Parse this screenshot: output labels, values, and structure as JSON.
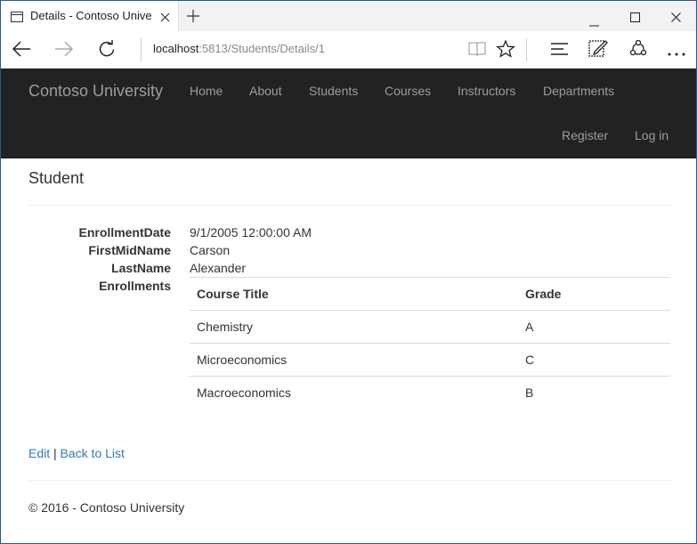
{
  "browser": {
    "tab_title": "Details - Contoso Unive",
    "url_host": "localhost",
    "url_rest": ":5813/Students/Details/1"
  },
  "site": {
    "brand": "Contoso University",
    "nav": [
      "Home",
      "About",
      "Students",
      "Courses",
      "Instructors",
      "Departments"
    ],
    "nav_right": [
      "Register",
      "Log in"
    ]
  },
  "page": {
    "heading": "Student",
    "fields": [
      {
        "label": "EnrollmentDate",
        "value": "9/1/2005 12:00:00 AM"
      },
      {
        "label": "FirstMidName",
        "value": "Carson"
      },
      {
        "label": "LastName",
        "value": "Alexander"
      },
      {
        "label": "Enrollments",
        "value": ""
      }
    ],
    "enrollments": {
      "headers": [
        "Course Title",
        "Grade"
      ],
      "rows": [
        [
          "Chemistry",
          "A"
        ],
        [
          "Microeconomics",
          "C"
        ],
        [
          "Macroeconomics",
          "B"
        ]
      ]
    },
    "edit_link": "Edit",
    "separator": "|",
    "back_link": "Back to List",
    "footer": "© 2016 - Contoso University"
  }
}
